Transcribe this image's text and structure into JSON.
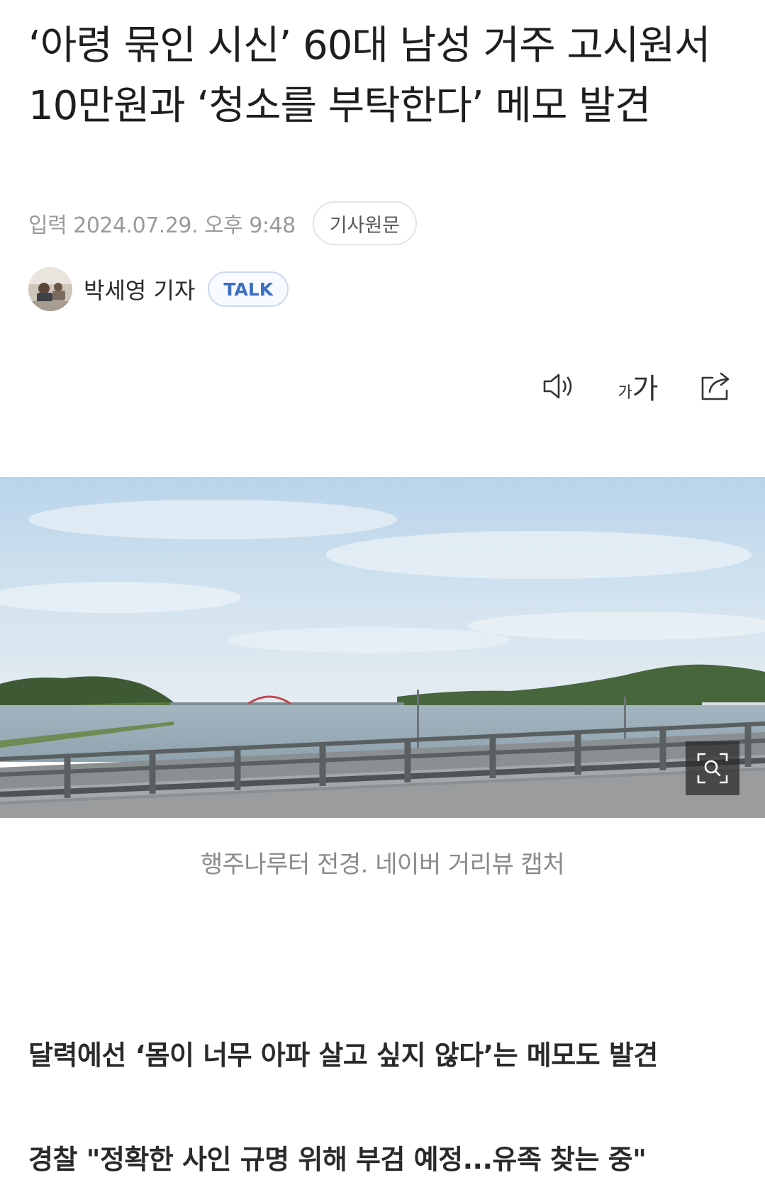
{
  "article": {
    "headline": "‘아령 묶인 시신’ 60대 남성 거주 고시원서 10만원과 ‘청소를 부탁한다’ 메모 발견",
    "date_label": "입력 2024.07.29. 오후 9:48",
    "original_button": "기사원문",
    "reporter_name": "박세영 기자",
    "talk_button": "TALK"
  },
  "toolbar": {
    "speaker_icon": "speaker-icon",
    "font_small": "가",
    "font_large": "가",
    "share_icon": "share-icon"
  },
  "photo": {
    "caption": "행주나루터 전경. 네이버 거리뷰 캡처",
    "zoom_icon": "zoom-icon"
  },
  "subheads": [
    "달력에선 ‘몸이 너무 아파 살고 싶지 않다’는 메모도 발견",
    "경찰 \"정확한 사인 규명 위해 부검 예정...유족 찾는 중\""
  ],
  "colors": {
    "accent_talk": "#3c6fc2",
    "meta_gray": "#9a9a9a"
  }
}
